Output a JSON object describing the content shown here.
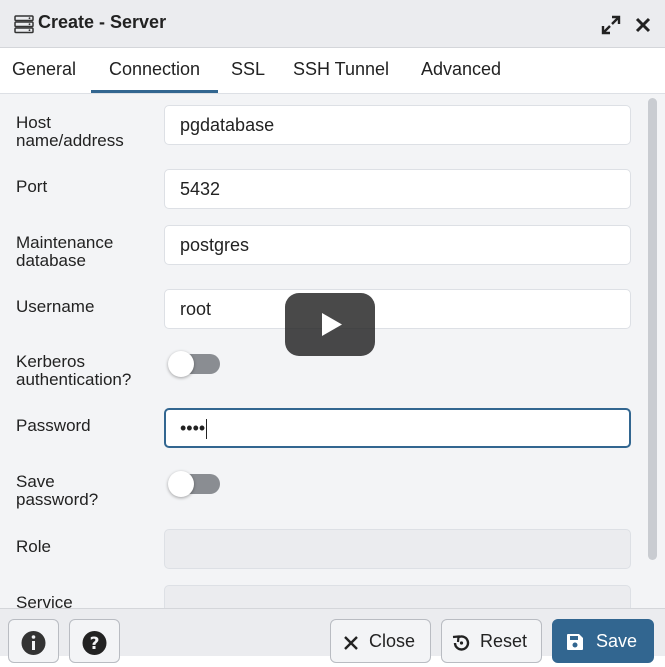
{
  "window": {
    "title": "Create - Server",
    "icon": "server-icon",
    "maximize_icon": "expand-arrows-icon",
    "close_icon": "close-icon"
  },
  "tabs": [
    {
      "label": "General",
      "active": false
    },
    {
      "label": "Connection",
      "active": true
    },
    {
      "label": "SSL",
      "active": false
    },
    {
      "label": "SSH Tunnel",
      "active": false
    },
    {
      "label": "Advanced",
      "active": false
    }
  ],
  "form": {
    "host": {
      "label_line1": "Host",
      "label_line2": "name/address",
      "value": "pgdatabase"
    },
    "port": {
      "label": "Port",
      "value": "5432"
    },
    "maintenance_db": {
      "label_line1": "Maintenance",
      "label_line2": "database",
      "value": "postgres"
    },
    "username": {
      "label": "Username",
      "value": "root"
    },
    "kerberos": {
      "label_line1": "Kerberos",
      "label_line2": "authentication?",
      "enabled": false
    },
    "password": {
      "label": "Password",
      "value": "••••"
    },
    "save_password": {
      "label_line1": "Save",
      "label_line2": "password?",
      "enabled": false
    },
    "role": {
      "label": "Role",
      "value": ""
    },
    "service": {
      "label": "Service",
      "value": ""
    }
  },
  "footer": {
    "info_icon": "info-icon",
    "help_icon": "help-icon",
    "close_label": "Close",
    "reset_label": "Reset",
    "save_label": "Save"
  },
  "overlay": {
    "icon": "play-icon"
  },
  "colors": {
    "accent": "#326690",
    "titlebar_bg": "#ebecef",
    "content_bg": "#f3f4f6",
    "toggle_off": "#8a8d92"
  }
}
